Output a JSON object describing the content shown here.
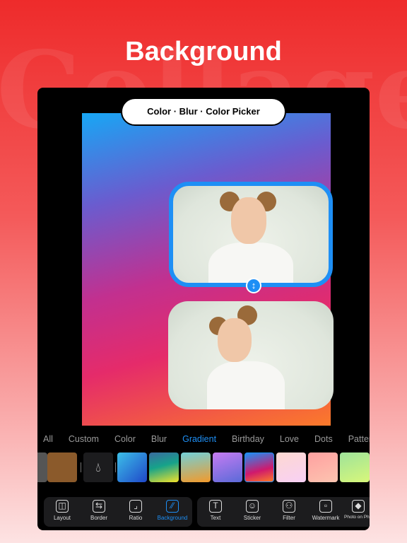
{
  "watermark": "Collage",
  "title": "Background",
  "banner": "Color · Blur · Color Picker",
  "categories": [
    "All",
    "Custom",
    "Color",
    "Blur",
    "Gradient",
    "Birthday",
    "Love",
    "Dots",
    "Pattern"
  ],
  "active_category": "Gradient",
  "swatches": [
    "#555555",
    "#8b5a2b",
    "picker",
    "linear-gradient(135deg,#3cbfe8,#1f47c9)",
    "linear-gradient(165deg,#3a6aa0,#16a38a 45%,#f2e22a)",
    "linear-gradient(170deg,#72d0d8,#f39a2b)",
    "linear-gradient(160deg,#c77cf2,#5a6ad8)",
    "linear-gradient(165deg,#1e8ff5,#d0196d 60%,#fb7a2a)",
    "linear-gradient(160deg,#fdd8d0,#f8d0f5)",
    "linear-gradient(160deg,#ffa0a0,#fcc4b0)",
    "linear-gradient(160deg,#9ee39a,#d8f77a)"
  ],
  "tools_left": [
    {
      "label": "Layout",
      "icon": "layout-icon",
      "glyph": "◫"
    },
    {
      "label": "Border",
      "icon": "border-icon",
      "glyph": "⇆"
    },
    {
      "label": "Ratio",
      "icon": "ratio-icon",
      "glyph": "⌟"
    },
    {
      "label": "Background",
      "icon": "background-icon",
      "glyph": "⁄⁄",
      "active": true
    }
  ],
  "tools_right": [
    {
      "label": "Text",
      "icon": "text-icon",
      "glyph": "T"
    },
    {
      "label": "Sticker",
      "icon": "sticker-icon",
      "glyph": "☺"
    },
    {
      "label": "Filter",
      "icon": "filter-icon",
      "glyph": "⚇"
    },
    {
      "label": "Watermark",
      "icon": "watermark-icon",
      "glyph": "▫"
    },
    {
      "label": "Photo on Photo",
      "icon": "photo-on-photo-icon",
      "glyph": "◆"
    }
  ],
  "accent": "#1e8ff5"
}
